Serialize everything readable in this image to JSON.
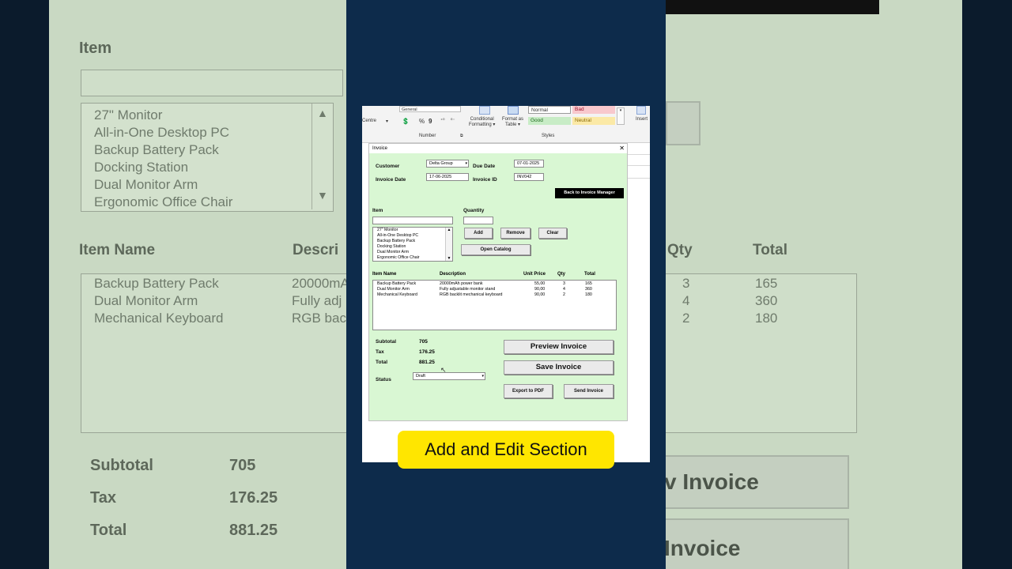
{
  "caption": "Add and Edit Section",
  "ribbon": {
    "number_format": "General",
    "centre": "Centre",
    "number_group": "Number",
    "styles_group": "Styles",
    "conditional": "Conditional",
    "formatting": "Formatting",
    "format_as": "Format as",
    "table": "Table",
    "insert": "Insert",
    "styles": {
      "normal": "Normal",
      "bad": "Bad",
      "good": "Good",
      "neutral": "Neutral"
    }
  },
  "dialog": {
    "title": "Invoice",
    "customer_label": "Customer",
    "customer_value": "Delta Group",
    "due_date_label": "Due Date",
    "due_date_value": "07-01-2025",
    "invoice_date_label": "Invoice Date",
    "invoice_date_value": "17-06-2025",
    "invoice_id_label": "Invoice ID",
    "invoice_id_value": "INV042",
    "back_button": "Back to Invoice Manager",
    "item_label": "Item",
    "quantity_label": "Quantity",
    "add_button": "Add",
    "remove_button": "Remove",
    "clear_button": "Clear",
    "open_catalog_button": "Open Catalog",
    "catalog_items": [
      "27\" Monitor",
      "All-in-One Desktop PC",
      "Backup Battery Pack",
      "Docking Station",
      "Dual Monitor Arm",
      "Ergonomic Office Chair"
    ],
    "table_headers": {
      "item_name": "Item Name",
      "description": "Description",
      "unit_price": "Unit Price",
      "qty": "Qty",
      "total": "Total"
    },
    "lines": [
      {
        "item": "Backup Battery Pack",
        "description": "20000mAh power bank",
        "price": "55,00",
        "qty": "3",
        "total": "165"
      },
      {
        "item": "Dual Monitor Arm",
        "description": "Fully adjustable monitor stand",
        "price": "90,00",
        "qty": "4",
        "total": "360"
      },
      {
        "item": "Mechanical Keyboard",
        "description": "RGB backlit mechanical keyboard",
        "price": "90,00",
        "qty": "2",
        "total": "180"
      }
    ],
    "subtotal_label": "Subtotal",
    "subtotal_value": "705",
    "tax_label": "Tax",
    "tax_value": "176.25",
    "total_label": "Total",
    "total_value": "881.25",
    "status_label": "Status",
    "status_value": "Draft",
    "preview_button": "Preview Invoice",
    "save_button": "Save Invoice",
    "export_button": "Export to PDF",
    "send_button": "Send Invoice"
  },
  "background_left": {
    "item_label": "Item",
    "items": [
      "27\" Monitor",
      "All-in-One Desktop PC",
      "Backup Battery Pack",
      "Docking Station",
      "Dual Monitor Arm",
      "Ergonomic Office Chair"
    ],
    "item_name_header": "Item Name",
    "descr_header": "Descri",
    "rows": [
      {
        "name": "Backup Battery Pack",
        "desc": "20000mA"
      },
      {
        "name": "Dual Monitor Arm",
        "desc": "Fully adj"
      },
      {
        "name": "Mechanical Keyboard",
        "desc": "RGB bac"
      }
    ],
    "subtotal_label": "Subtotal",
    "subtotal_value": "705",
    "tax_label": "Tax",
    "tax_value": "176.25",
    "total_label": "Total",
    "total_value": "881.25"
  },
  "background_right": {
    "qty_header": "Qty",
    "total_header": "Total",
    "rows": [
      {
        "qty": "3",
        "total": "165"
      },
      {
        "qty": "4",
        "total": "360"
      },
      {
        "qty": "2",
        "total": "180"
      }
    ],
    "preview_fragment": "v Invoice",
    "save_fragment": "Invoice"
  }
}
